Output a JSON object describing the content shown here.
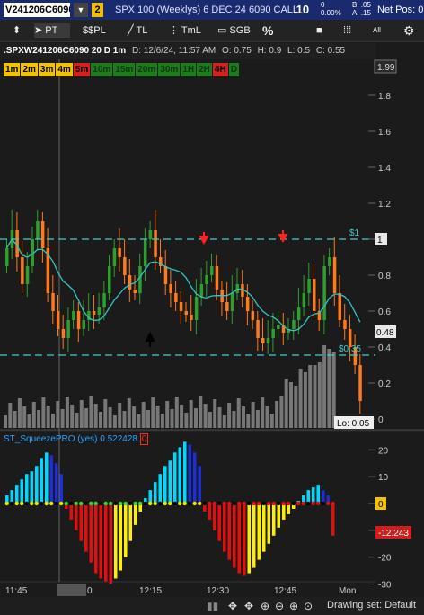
{
  "header": {
    "symbol": "V241206C6090",
    "link_badge": "2",
    "description": "SPX 100 (Weeklys) 6 DEC 24 6090 CALL",
    "last": ".10",
    "change_top": "0",
    "change_bottom": "0.00%",
    "bid": "B: .05",
    "ask": "A: .15",
    "net_pos": "Net Pos: 0"
  },
  "toolbar": {
    "pointer_label": "PT",
    "pl_label": "$PL",
    "tl_label": "TL",
    "tml_label": "TmL",
    "sgb_label": "SGB",
    "percent_label": "%",
    "all_label": "All"
  },
  "info": {
    "symbol": ".SPXW241206C6090 20 D 1m",
    "date": "D: 12/6/24, 11:57 AM",
    "open": "O: 0.75",
    "high": "H: 0.9",
    "low": "L: 0.5",
    "close": "C: 0.55"
  },
  "timeframes": [
    {
      "label": "1m",
      "bg": "#f2c200",
      "fg": "#000"
    },
    {
      "label": "2m",
      "bg": "#f2c200",
      "fg": "#000"
    },
    {
      "label": "3m",
      "bg": "#f2c200",
      "fg": "#000"
    },
    {
      "label": "4m",
      "bg": "#f2c200",
      "fg": "#000"
    },
    {
      "label": "5m",
      "bg": "#d42020",
      "fg": "#000"
    },
    {
      "label": "10m",
      "bg": "#1f7a1f",
      "fg": "#0a3a0a"
    },
    {
      "label": "15m",
      "bg": "#1f7a1f",
      "fg": "#0a3a0a"
    },
    {
      "label": "20m",
      "bg": "#1f7a1f",
      "fg": "#0a3a0a"
    },
    {
      "label": "30m",
      "bg": "#1f7a1f",
      "fg": "#0a3a0a"
    },
    {
      "label": "1H",
      "bg": "#1f7a1f",
      "fg": "#0a3a0a"
    },
    {
      "label": "2H",
      "bg": "#1f7a1f",
      "fg": "#0a3a0a"
    },
    {
      "label": "4H",
      "bg": "#d42020",
      "fg": "#000"
    },
    {
      "label": "D",
      "bg": "#1f7a1f",
      "fg": "#0a3a0a"
    }
  ],
  "indicator": {
    "name": "ST_SqueezePRO (yes)",
    "value": "0.522428",
    "zero": "0"
  },
  "price_axis": {
    "ticks": [
      "1.8",
      "1.6",
      "1.4",
      "1.2",
      "1",
      "0.8",
      "0.6",
      "0.4",
      "0.2",
      "0"
    ],
    "top_badge": "1.99",
    "badge_1": "1",
    "badge_048": "0.48",
    "lo_label": "Lo: 0.05"
  },
  "lower_axis": {
    "ticks": [
      "20",
      "10",
      "0",
      "-10",
      "-20",
      "-30"
    ],
    "value_badge": "-12.243",
    "zero_badge": "0"
  },
  "annotations": {
    "upper_line_label": "$1",
    "lower_line_label": "$0.35"
  },
  "time_axis": {
    "labels": [
      "11:45",
      "11:57",
      "0",
      "12:15",
      "12:30",
      "12:45",
      "Mon"
    ]
  },
  "status": {
    "drawing_set": "Drawing set: Default"
  },
  "colors": {
    "up_candle": "#2e9e2e",
    "down_candle": "#ff7a1a",
    "ma_line": "#33c4c4",
    "dashed_line": "#44cccc",
    "volume": "#777777",
    "hist_cyan": "#00d8ff",
    "hist_blue": "#1a2fd6",
    "hist_red": "#e01010",
    "hist_yellow": "#ffee00"
  },
  "chart_data": {
    "type": "candlestick",
    "ylim": [
      0,
      1.99
    ],
    "price_levels": [
      1.0,
      0.35
    ],
    "histogram_ylim": [
      -32,
      24
    ],
    "histogram": [
      3,
      5,
      7,
      9,
      11,
      12,
      14,
      17,
      19,
      18,
      15,
      11,
      -2,
      -6,
      -10,
      -14,
      -18,
      -22,
      -26,
      -28,
      -29,
      -30,
      -28,
      -25,
      -20,
      -14,
      -8,
      -3,
      2,
      5,
      8,
      11,
      14,
      16,
      19,
      21,
      23,
      22,
      19,
      14,
      -3,
      -6,
      -10,
      -14,
      -18,
      -21,
      -24,
      -26,
      -27,
      -26,
      -24,
      -21,
      -18,
      -15,
      -12,
      -9,
      -6,
      -4,
      -2,
      1,
      3,
      5,
      6,
      7,
      5,
      3,
      -12
    ]
  }
}
